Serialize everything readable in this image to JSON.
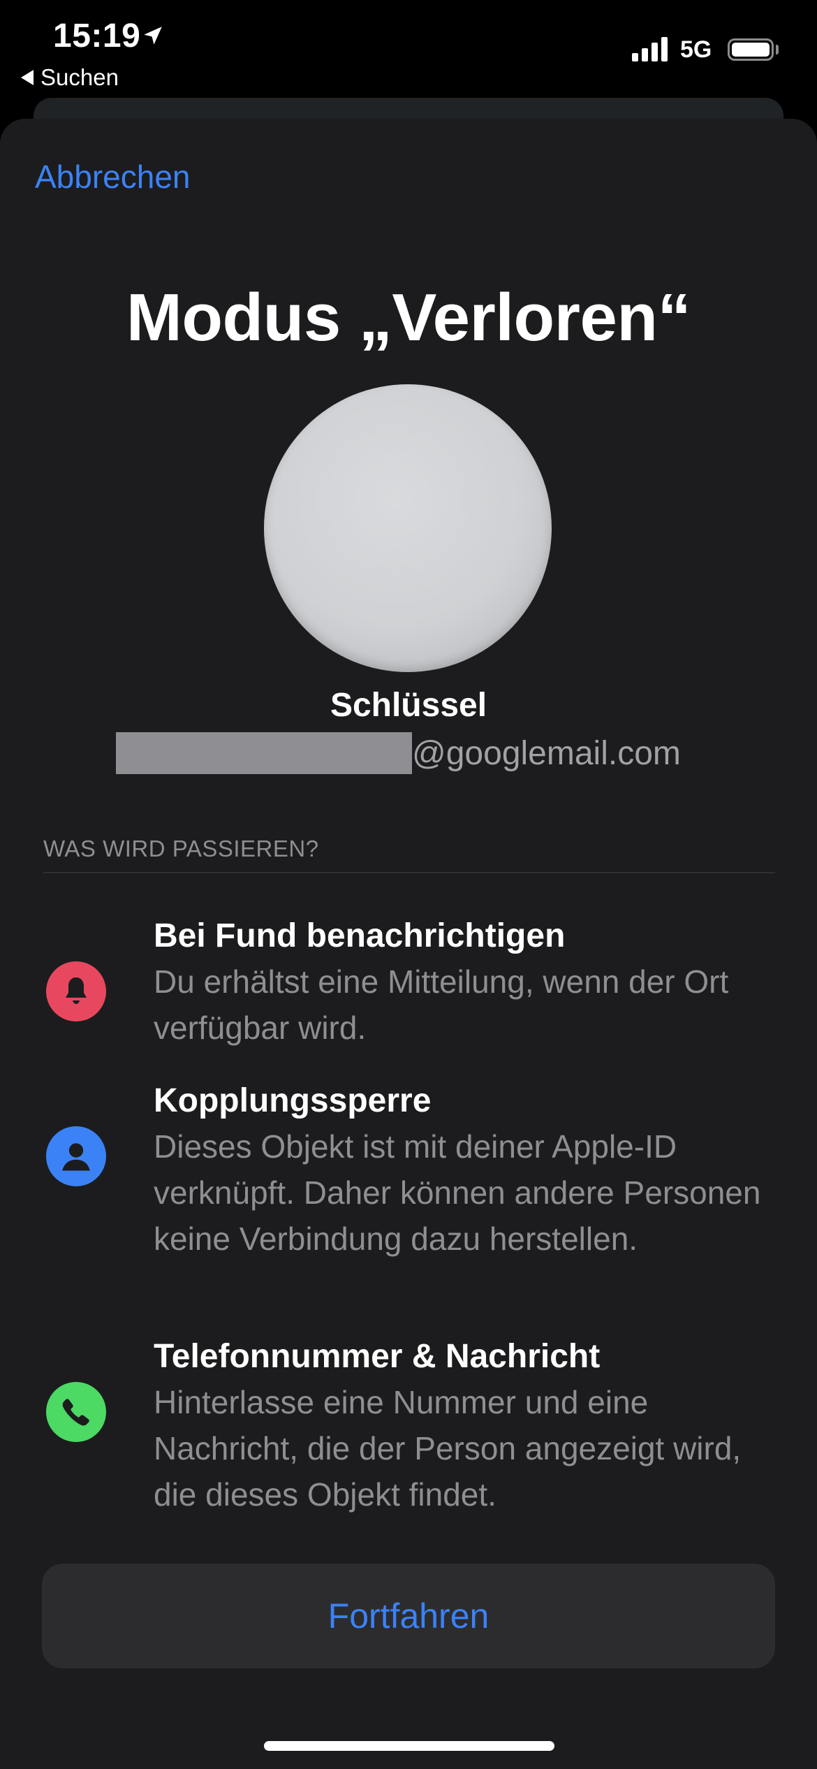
{
  "status_bar": {
    "time": "15:19",
    "back_label": "Suchen",
    "network": "5G"
  },
  "sheet": {
    "cancel_label": "Abbrechen",
    "title": "Modus „Verloren“",
    "item_name": "Schlüssel",
    "email_domain": "@googlemail.com"
  },
  "section": {
    "header": "WAS WIRD PASSIEREN?",
    "features": [
      {
        "icon": "bell-icon",
        "icon_color": "#e8485f",
        "title": "Bei Fund benachrichtigen",
        "description": "Du erhältst eine Mitteilung, wenn der Ort verfügbar wird."
      },
      {
        "icon": "person-icon",
        "icon_color": "#3b82f6",
        "title": "Kopplungssperre",
        "description": "Dieses Objekt ist mit deiner Apple-ID verknüpft. Daher können andere Personen keine Verbindung dazu herstellen."
      },
      {
        "icon": "phone-icon",
        "icon_color": "#4cd964",
        "title": "Telefonnummer & Nachricht",
        "description": "Hinterlasse eine Nummer und eine Nachricht, die der Person angezeigt wird, die dieses Objekt findet."
      }
    ]
  },
  "actions": {
    "continue_label": "Fortfahren"
  },
  "colors": {
    "accent": "#3b82f6",
    "sheet_background": "#1c1c1e",
    "button_background": "#2c2c2e",
    "secondary_text": "#8e8e93"
  }
}
